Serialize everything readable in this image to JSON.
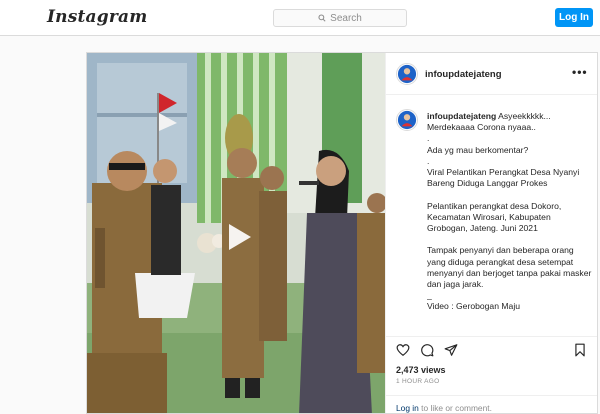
{
  "app": {
    "logo_text": "Instagram"
  },
  "search": {
    "placeholder": "Search",
    "icon": "search-icon"
  },
  "header": {
    "login_label": "Log In"
  },
  "post": {
    "username": "infoupdatejateng",
    "more_icon": "more-options-icon",
    "more_glyph": "•••",
    "caption": {
      "username": "infoupdatejateng",
      "text": " Asyeekkkkk...\nMerdekaaaa Corona nyaaa..\n.\nAda yg mau berkomentar?\n.\nViral Pelantikan Perangkat Desa Nyanyi Bareng Diduga Langgar Prokes\n\nPelantikan perangkat desa Dokoro, Kecamatan Wirosari, Kabupaten Grobogan, Jateng. Juni 2021\n\nTampak penyanyi dan beberapa orang yang diduga perangkat desa setempat menyanyi dan berjoget tanpa pakai masker dan jaga jarak.\n_\nVideo : Gerobogan Maju"
    },
    "views": "2,473 views",
    "time_ago": "1 HOUR AGO",
    "login_prompt": {
      "link": "Log in",
      "rest": " to like or comment."
    },
    "actions": [
      "heart-icon",
      "comment-icon",
      "share-icon",
      "bookmark-icon"
    ],
    "colors": {
      "accent": "#0095f6",
      "link": "#00376b",
      "muted": "#8e8e8e",
      "border": "#dbdbdb"
    }
  }
}
